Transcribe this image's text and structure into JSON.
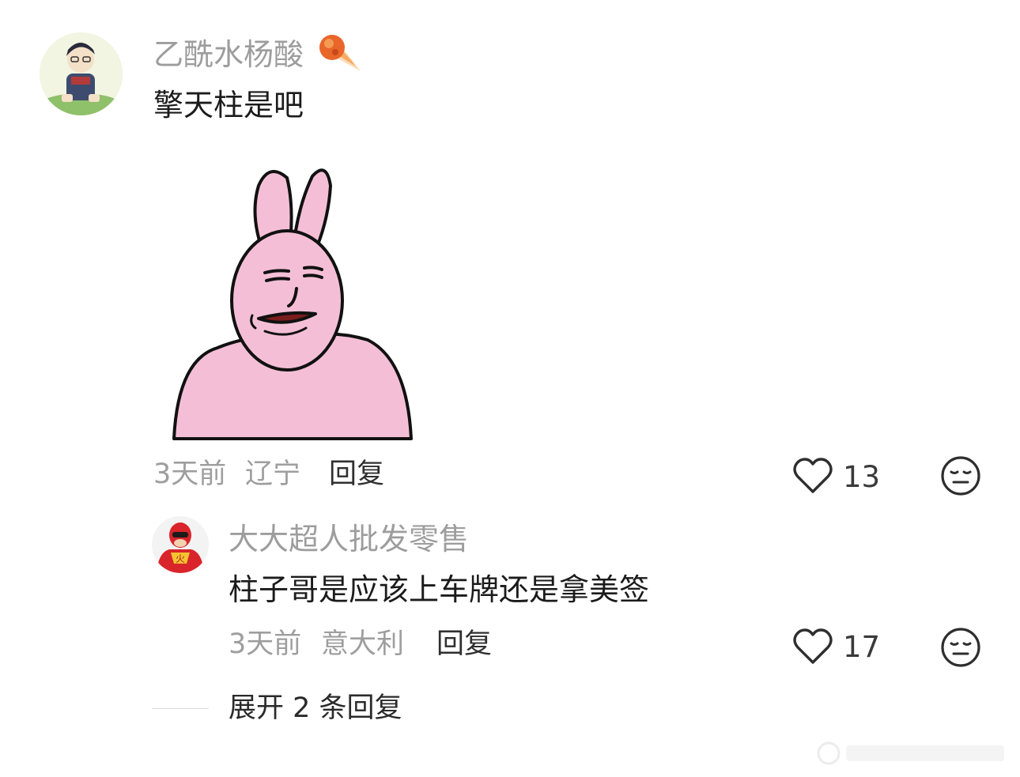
{
  "comment": {
    "username": "乙酰水杨酸",
    "text": "擎天柱是吧",
    "time": "3天前",
    "location": "辽宁",
    "reply_label": "回复",
    "likes": "13",
    "sticker_name": "pink-rabbit-sticker",
    "badge_icon": "fireball-badge-icon"
  },
  "reply": {
    "username": "大大超人批发零售",
    "text": "柱子哥是应该上车牌还是拿美签",
    "time": "3天前",
    "location": "意大利",
    "reply_label": "回复",
    "likes": "17"
  },
  "expand": {
    "label": "展开 2 条回复"
  },
  "colors": {
    "username": "#9d9d9d",
    "rabbit_pink": "#f4bfd6",
    "outline": "#111111"
  }
}
